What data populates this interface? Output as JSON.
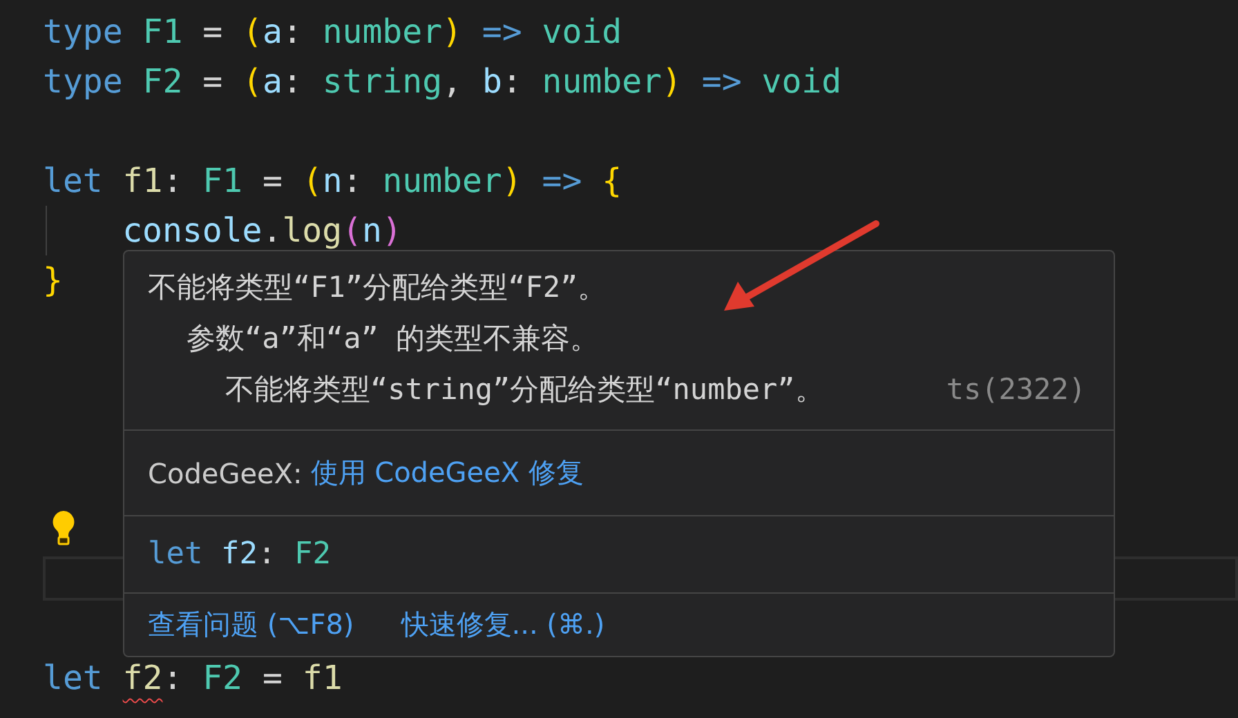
{
  "editor": {
    "lines": [
      {
        "current": false,
        "indent_guide": false,
        "tokens": [
          {
            "t": "type ",
            "kind": "keyword"
          },
          {
            "t": "F1",
            "kind": "type"
          },
          {
            "t": " = ",
            "kind": "punct"
          },
          {
            "t": "(",
            "kind": "bracket1"
          },
          {
            "t": "a",
            "kind": "var"
          },
          {
            "t": ": ",
            "kind": "punct"
          },
          {
            "t": "number",
            "kind": "type"
          },
          {
            "t": ")",
            "kind": "bracket1"
          },
          {
            "t": " => ",
            "kind": "keyword"
          },
          {
            "t": "void",
            "kind": "type"
          }
        ]
      },
      {
        "current": false,
        "indent_guide": false,
        "tokens": [
          {
            "t": "type ",
            "kind": "keyword"
          },
          {
            "t": "F2",
            "kind": "type"
          },
          {
            "t": " = ",
            "kind": "punct"
          },
          {
            "t": "(",
            "kind": "bracket1"
          },
          {
            "t": "a",
            "kind": "var"
          },
          {
            "t": ": ",
            "kind": "punct"
          },
          {
            "t": "string",
            "kind": "type"
          },
          {
            "t": ", ",
            "kind": "punct"
          },
          {
            "t": "b",
            "kind": "var"
          },
          {
            "t": ": ",
            "kind": "punct"
          },
          {
            "t": "number",
            "kind": "type"
          },
          {
            "t": ")",
            "kind": "bracket1"
          },
          {
            "t": " => ",
            "kind": "keyword"
          },
          {
            "t": "void",
            "kind": "type"
          }
        ]
      },
      {
        "current": false,
        "indent_guide": false
      },
      {
        "current": false,
        "indent_guide": false,
        "tokens": [
          {
            "t": "let ",
            "kind": "keyword"
          },
          {
            "t": "f1",
            "kind": "func"
          },
          {
            "t": ": ",
            "kind": "punct"
          },
          {
            "t": "F1",
            "kind": "type"
          },
          {
            "t": " = ",
            "kind": "punct"
          },
          {
            "t": "(",
            "kind": "bracket1"
          },
          {
            "t": "n",
            "kind": "var"
          },
          {
            "t": ": ",
            "kind": "punct"
          },
          {
            "t": "number",
            "kind": "type"
          },
          {
            "t": ")",
            "kind": "bracket1"
          },
          {
            "t": " => ",
            "kind": "keyword"
          },
          {
            "t": "{",
            "kind": "bracket1"
          }
        ]
      },
      {
        "current": false,
        "indent_guide": true,
        "tokens": [
          {
            "t": "console",
            "kind": "var"
          },
          {
            "t": ".",
            "kind": "punct"
          },
          {
            "t": "log",
            "kind": "func"
          },
          {
            "t": "(",
            "kind": "bracket2"
          },
          {
            "t": "n",
            "kind": "var"
          },
          {
            "t": ")",
            "kind": "bracket2"
          }
        ]
      },
      {
        "current": false,
        "indent_guide": false,
        "tokens": [
          {
            "t": "}",
            "kind": "bracket1"
          }
        ]
      },
      {
        "current": false,
        "indent_guide": false
      },
      {
        "current": false,
        "indent_guide": false
      },
      {
        "current": false,
        "indent_guide": false
      },
      {
        "current": false,
        "indent_guide": false
      },
      {
        "current": false,
        "indent_guide": false,
        "lightbulb": true
      },
      {
        "current": true,
        "indent_guide": false
      },
      {
        "current": false,
        "indent_guide": false
      },
      {
        "current": false,
        "indent_guide": false,
        "tokens": [
          {
            "t": "let ",
            "kind": "keyword"
          },
          {
            "t": "f2",
            "kind": "func",
            "error": true
          },
          {
            "t": ": ",
            "kind": "punct"
          },
          {
            "t": "F2",
            "kind": "type"
          },
          {
            "t": " = ",
            "kind": "punct"
          },
          {
            "t": "f1",
            "kind": "func"
          }
        ]
      }
    ]
  },
  "hover": {
    "message": {
      "text": "不能将类型“F1”分配给类型“F2”。",
      "children": [
        {
          "text": "参数“a”和“a” 的类型不兼容。",
          "children": [
            {
              "text": "不能将类型“string”分配给类型“number”。"
            }
          ]
        }
      ]
    },
    "code": "ts(2322)",
    "assistant": {
      "label": "CodeGeeX:",
      "link": "使用 CodeGeeX 修复"
    },
    "preview": [
      {
        "t": "let ",
        "kind": "keyword"
      },
      {
        "t": "f2",
        "kind": "var"
      },
      {
        "t": ": ",
        "kind": "punct"
      },
      {
        "t": "F2",
        "kind": "type"
      }
    ],
    "actions": [
      "查看问题 (⌥F8)",
      "快速修复... (⌘.)"
    ]
  }
}
